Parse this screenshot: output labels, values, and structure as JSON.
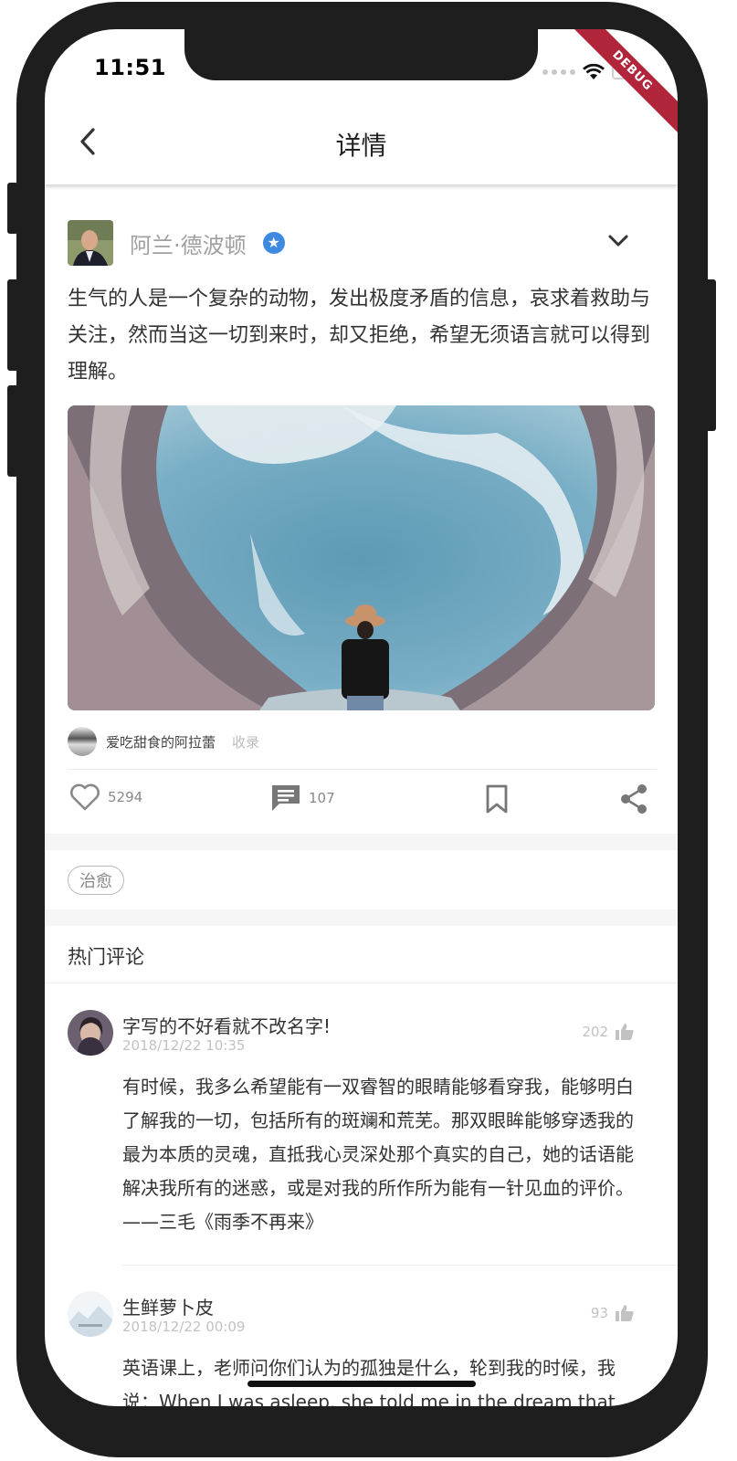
{
  "status_bar": {
    "time": "11:51",
    "debug_label": "DEBUG"
  },
  "app_bar": {
    "title": "详情"
  },
  "post": {
    "author": "阿兰·德波顿",
    "verified_icon": "star-badge-icon",
    "content": "生气的人是一个复杂的动物，发出极度矛盾的信息，哀求着救助与关注，然而当这一切到来时，却又拒绝，希望无须语言就可以得到理解。",
    "image_credit": {
      "name": "爱吃甜食的阿拉蕾",
      "label": "收录"
    },
    "actions": {
      "likes": "5294",
      "comments": "107"
    },
    "tag": "治愈"
  },
  "comments_section": {
    "title": "热门评论",
    "items": [
      {
        "name": "字写的不好看就不改名字!",
        "time": "2018/12/22 10:35",
        "likes": "202",
        "text": "有时候，我多么希望能有一双睿智的眼睛能够看穿我，能够明白了解我的一切，包括所有的斑斓和荒芜。那双眼眸能够穿透我的最为本质的灵魂，直抵我心灵深处那个真实的自己，她的话语能解决我所有的迷惑，或是对我的所作所为能有一针见血的评价。——三毛《雨季不再来》"
      },
      {
        "name": "生鲜萝卜皮",
        "time": "2018/12/22 00:09",
        "likes": "93",
        "text": "英语课上，老师问你们认为的孤独是什么，轮到我的时候，我说：When I was asleep, she told me in the dream that"
      }
    ]
  },
  "colors": {
    "accent": "#3d8ae0",
    "debug": "#b0253a",
    "bezel": "#1e1e1e"
  }
}
